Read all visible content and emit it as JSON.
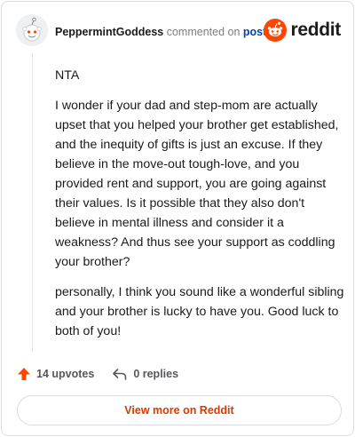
{
  "comment": {
    "author": "PeppermintGoddess",
    "action_text": "commented on",
    "post_link": "post",
    "paragraphs": [
      "NTA",
      "I wonder if your dad and step-mom are actually upset that you helped your brother get established, and the inequity of gifts is just an excuse. If they believe in the move-out tough-love, and you provided rent and support, you are going against their values. Is it possible that they also don't believe in mental illness and consider it a weakness? And thus see your support as coddling your brother?",
      "personally, I think you sound like a wonderful sibling and your brother is lucky to have you. Good luck to both of you!"
    ]
  },
  "brand": {
    "name": "reddit",
    "icon": "reddit-logo-icon",
    "accent": "#ff4500"
  },
  "actions": {
    "upvotes_label": "14 upvotes",
    "replies_label": "0 replies",
    "upvote_icon": "upvote-arrow-icon",
    "reply_icon": "reply-arrow-icon"
  },
  "cta": {
    "label": "View more on Reddit",
    "color": "#d93a00"
  }
}
